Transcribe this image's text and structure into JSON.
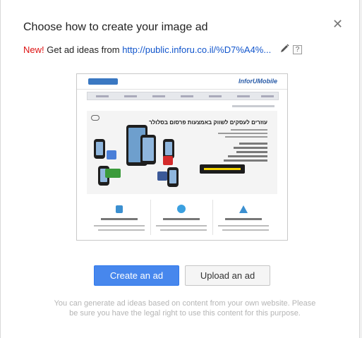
{
  "dialog": {
    "title": "Choose how to create your image ad",
    "close_icon": "close-icon"
  },
  "ideas": {
    "new_label": "New!",
    "text": "Get ad ideas from",
    "url": "http://public.inforu.co.il/%D7%A4%...",
    "edit_icon": "pencil-icon",
    "help_label": "?"
  },
  "preview": {
    "logo_text": "InforUMobile",
    "headline": "עוזרים לעסקים לשווק באמצעות פרסום בסלולר"
  },
  "buttons": {
    "create_label": "Create an ad",
    "upload_label": "Upload an ad"
  },
  "note": "You can generate ad ideas based on content from your own website. Please be sure you have the legal right to use this content for this purpose.",
  "colors": {
    "primary": "#4787ed",
    "new": "#dd1111",
    "link": "#1155cc"
  }
}
